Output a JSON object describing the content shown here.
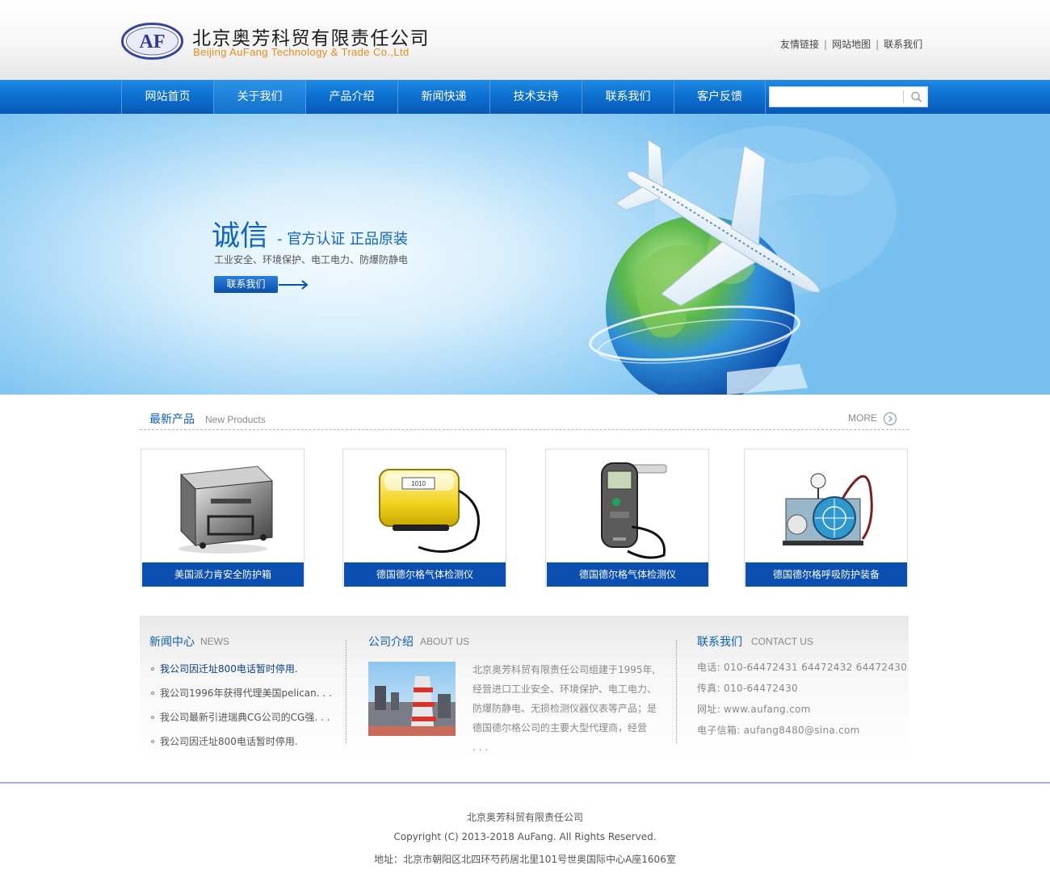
{
  "header": {
    "logo_text": "AF",
    "company_cn": "北京奥芳科贸有限责任公司",
    "company_en": "Beijing AuFang Technology & Trade Co.,Ltd",
    "top_links": [
      "友情链接",
      "网站地图",
      "联系我们"
    ]
  },
  "nav": {
    "items": [
      {
        "label": "网站首页"
      },
      {
        "label": "关于我们"
      },
      {
        "label": "产品介绍"
      },
      {
        "label": "新闻快递"
      },
      {
        "label": "技术支持"
      },
      {
        "label": "联系我们"
      },
      {
        "label": "客户反馈"
      }
    ],
    "active_index": 1,
    "search": {
      "value": "",
      "placeholder": "",
      "icon": "search-icon"
    }
  },
  "banner": {
    "title": "诚信",
    "subtitle": "- 官方认证 正品原装",
    "description": "工业安全、环境保护、电工电力、防爆防静电",
    "button_label": "联系我们"
  },
  "products": {
    "heading_cn": "最新产品",
    "heading_en": "New Products",
    "more_label": "MORE",
    "items": [
      {
        "name": "美国派力肯安全防护箱",
        "image": "protective-case"
      },
      {
        "name": "德国德尔格气体检测仪",
        "image": "yellow-case"
      },
      {
        "name": "德国德尔格气体检测仪",
        "image": "gas-detector"
      },
      {
        "name": "德国德尔格呼吸防护装备",
        "image": "breathing-compressor"
      }
    ]
  },
  "news": {
    "heading_cn": "新闻中心",
    "heading_en": "NEWS",
    "items": [
      "我公司因迁址800电话暂时停用.",
      "我公司1996年获得代理美国pelican. . .",
      "我公司最新引进瑞典CG公司的CG强. . .",
      "我公司因迁址800电话暂时停用."
    ]
  },
  "about": {
    "heading_cn": "公司介绍",
    "heading_en": "ABOUT US",
    "image": "industrial-plant",
    "lines": [
      "北京奥芳科贸有限责任公司组建于1995年,",
      "经营进口工业安全、环境保护、电工电力、",
      "防爆防静电、无损检测仪器仪表等产品；是",
      "德国德尔格公司的主要大型代理商，经营",
      ". . ."
    ]
  },
  "contact": {
    "heading_cn": "联系我们",
    "heading_en": "CONTACT US",
    "lines": [
      "电话: 010-64472431   64472432   64472430",
      "传真: 010-64472430",
      "网址: www.aufang.com",
      "电子信箱: aufang8480@sina.com"
    ]
  },
  "footer": {
    "company": "北京奥芳科贸有限责任公司",
    "copyright": "Copyright (C) 2013-2018 AuFang. All Rights Reserved.",
    "address": "地址：北京市朝阳区北四环芍药居北里101号世奥国际中心A座1606室"
  },
  "colors": {
    "brand_blue": "#0b4fb0",
    "nav_blue": "#0c6fcf",
    "accent_orange": "#e88a17",
    "heading_blue": "#0d5fb8"
  }
}
